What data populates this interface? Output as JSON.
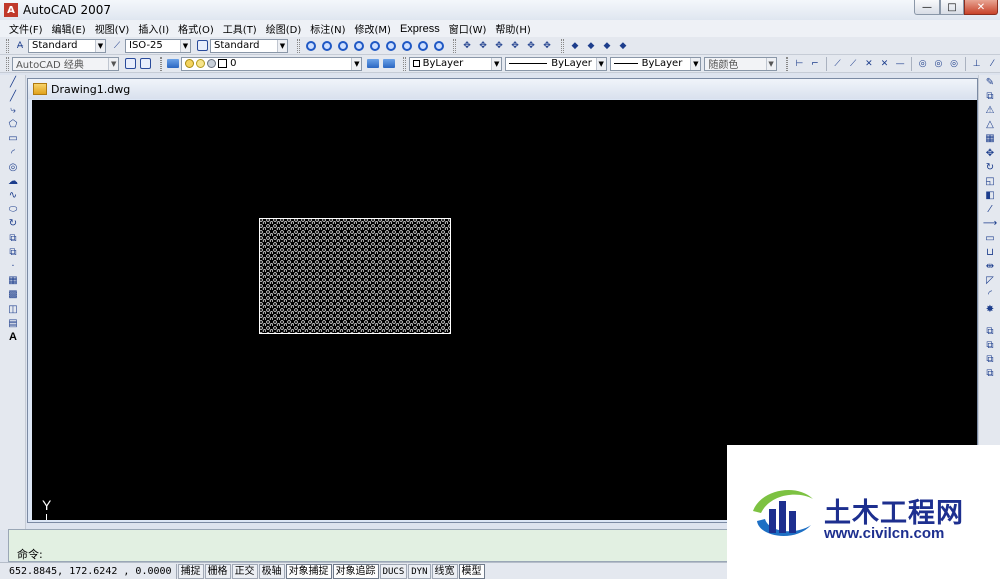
{
  "window": {
    "title": "AutoCAD 2007",
    "min_glyph": "—",
    "max_glyph": "□",
    "close_glyph": "✕"
  },
  "menu": [
    "文件(F)",
    "编辑(E)",
    "视图(V)",
    "插入(I)",
    "格式(O)",
    "工具(T)",
    "绘图(D)",
    "标注(N)",
    "修改(M)",
    "Express",
    "窗口(W)",
    "帮助(H)"
  ],
  "toolbar1": {
    "text_style": "Standard",
    "dim_style": "ISO-25",
    "table_style": "Standard"
  },
  "toolbar2": {
    "workspace": "AutoCAD 经典",
    "layer": "0",
    "color": "ByLayer",
    "linetype": "ByLayer",
    "lineweight": "ByLayer",
    "plot_style": "随颜色"
  },
  "document": {
    "tab_title": "Drawing1.dwg",
    "ucs_label": "Y"
  },
  "command": {
    "prompt": "命令:"
  },
  "status": {
    "coordinates": "652.8845,  172.6242 , 0.0000",
    "buttons": [
      {
        "label": "捕捉",
        "on": false
      },
      {
        "label": "栅格",
        "on": false
      },
      {
        "label": "正交",
        "on": false
      },
      {
        "label": "极轴",
        "on": false
      },
      {
        "label": "对象捕捉",
        "on": true
      },
      {
        "label": "对象追踪",
        "on": true
      },
      {
        "label": "DUCS",
        "on": false
      },
      {
        "label": "DYN",
        "on": false
      },
      {
        "label": "线宽",
        "on": false
      },
      {
        "label": "模型",
        "on": true
      }
    ]
  },
  "watermark": {
    "name": "土木工程网",
    "url": "www.civilcn.com"
  },
  "colors": {
    "canvas": "#000000",
    "command_bg": "#e2f0e2",
    "watermark_blue": "#1d2f8f",
    "watermark_green": "#7dc242"
  }
}
